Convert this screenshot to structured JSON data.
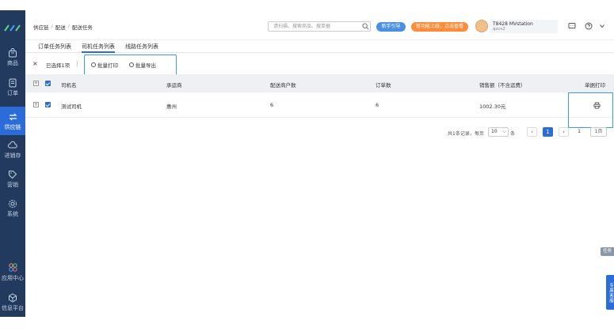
{
  "sidebar": {
    "items": [
      {
        "label": "商品",
        "icon": "shopping-bag-icon"
      },
      {
        "label": "订单",
        "icon": "order-list-icon"
      },
      {
        "label": "供应链",
        "icon": "transfer-icon"
      },
      {
        "label": "进销存",
        "icon": "cloud-inventory-icon"
      },
      {
        "label": "营销",
        "icon": "tag-icon"
      },
      {
        "label": "系统",
        "icon": "gear-icon"
      },
      {
        "label": "应用中心",
        "icon": "apps-icon"
      },
      {
        "label": "信息平台",
        "icon": "info-platform-icon"
      }
    ]
  },
  "header": {
    "breadcrumb": [
      "供应链",
      "配送",
      "配送任务"
    ],
    "search_placeholder": "请扫描、搜索商品、搜单据",
    "guide_button": "新手引导",
    "promo_button": "新功能上线，点击查看",
    "user_name": "T8428 MVstation",
    "user_sub": "qzcs2"
  },
  "tabs": [
    {
      "label": "订单任务列表",
      "active": false
    },
    {
      "label": "司机任务列表",
      "active": true
    },
    {
      "label": "线路任务列表",
      "active": false
    }
  ],
  "toolbar": {
    "close": "×",
    "selected_text": "已选择1项",
    "batch_print": "批量打印",
    "batch_export": "批量导出"
  },
  "table": {
    "columns": [
      "司机名",
      "承运商",
      "配送商户数",
      "订单数",
      "销售额（不含运费）",
      "单据打印"
    ],
    "rows": [
      {
        "driver": "测试司机",
        "carrier": "惠州",
        "merchants": "6",
        "orders": "6",
        "sales": "1002.30元"
      }
    ]
  },
  "pagination": {
    "total_text": "共1条记录，每页",
    "page_size": "10",
    "unit": "条",
    "prev": "‹",
    "current": "1",
    "next": "›",
    "goto_value": "1",
    "goto_label": "1页"
  },
  "float": {
    "task": "任务",
    "support": "专属客服"
  },
  "colors": {
    "sidebar_bg": "#223a5e",
    "accent": "#2b6cd8",
    "highlight": "#3d9bea",
    "promo": "#ff8c3a"
  }
}
